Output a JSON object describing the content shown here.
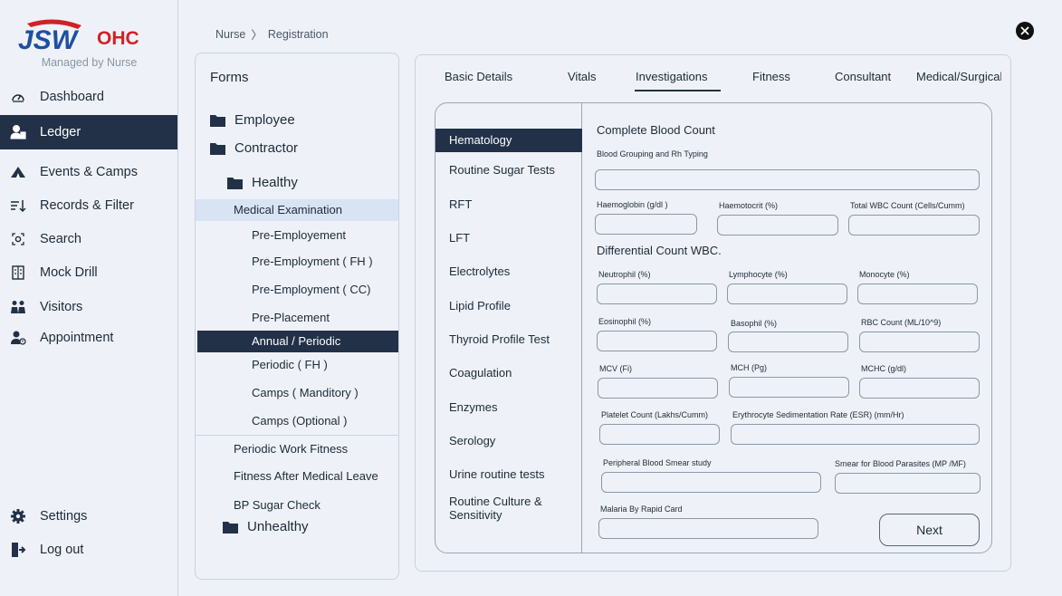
{
  "logo": {
    "brand": "JSW",
    "suffix": "OHC",
    "subtitle": "Managed by Nurse"
  },
  "sidebar": {
    "items": [
      {
        "label": "Dashboard",
        "icon": "speedometer-icon"
      },
      {
        "label": "Ledger",
        "icon": "user-ledger-icon"
      },
      {
        "label": "Events & Camps",
        "icon": "camp-icon"
      },
      {
        "label": "Records & Filter",
        "icon": "filter-sort-icon"
      },
      {
        "label": "Search",
        "icon": "search-icon"
      },
      {
        "label": "Mock Drill",
        "icon": "building-icon"
      },
      {
        "label": "Visitors",
        "icon": "visitors-icon"
      },
      {
        "label": "Appointment",
        "icon": "appointment-icon"
      }
    ],
    "settings": "Settings",
    "logout": "Log out"
  },
  "breadcrumb": {
    "root": "Nurse",
    "separator": "〉",
    "current": "Registration"
  },
  "forms": {
    "title": "Forms",
    "employee": "Employee",
    "contractor": "Contractor",
    "healthy": "Healthy",
    "medical_examination": "Medical Examination",
    "sub_items": [
      "Pre-Employement",
      "Pre-Employment ( FH )",
      "Pre-Employment ( CC)",
      "Pre-Placement",
      "Annual / Periodic",
      "Periodic ( FH )",
      "Camps ( Manditory )",
      "Camps (Optional )"
    ],
    "periodic_work_fitness": "Periodic Work Fitness",
    "fitness_after_leave": "Fitness After Medical Leave",
    "bp_sugar_check": "BP Sugar Check",
    "unhealthy": "Unhealthy"
  },
  "tabs": [
    "Basic Details",
    "Vitals",
    "Investigations",
    "Fitness",
    "Consultant",
    "Medical/Surgical History"
  ],
  "active_tab": "Investigations",
  "investigation_nav": [
    "Hematology",
    "Routine Sugar Tests",
    "RFT",
    "LFT",
    "Electrolytes",
    "Lipid Profile",
    "Thyroid Profile Test",
    "Coagulation",
    "Enzymes",
    "Serology",
    "Urine routine tests",
    "Routine Culture & Sensitivity"
  ],
  "hematology": {
    "cbc_title": "Complete Blood Count",
    "blood_grouping": "Blood Grouping and Rh Typing",
    "haemoglobin": "Haemoglobin (g/dl )",
    "haemotocrit": "Haemotocrit (%)",
    "total_wbc": "Total WBC Count (Cells/Cumm)",
    "differential_title": "Differential Count WBC.",
    "neutrophil": "Neutrophil (%)",
    "lymphocyte": "Lymphocyte (%)",
    "monocyte": "Monocyte (%)",
    "eosinophil": "Eosinophil (%)",
    "basophil": "Basophil (%)",
    "rbc_count": "RBC Count (ML/10^9)",
    "mcv": "MCV (Fi)",
    "mch": "MCH (Pg)",
    "mchc": "MCHC (g/dl)",
    "platelet": "Platelet Count (Lakhs/Cumm)",
    "esr": "Erythrocyte Sedimentation Rate (ESR) (mm/Hr)",
    "peripheral_smear": "Peripheral Blood Smear study",
    "smear_parasites": "Smear for Blood Parasites (MP /MF)",
    "malaria": "Malaria By Rapid Card"
  },
  "next_label": "Next",
  "colors": {
    "primary_dark": "#223148",
    "background": "#eef2f8",
    "highlight": "#d8e4f3",
    "brand_blue": "#1f4fa3",
    "brand_red": "#d32027"
  }
}
